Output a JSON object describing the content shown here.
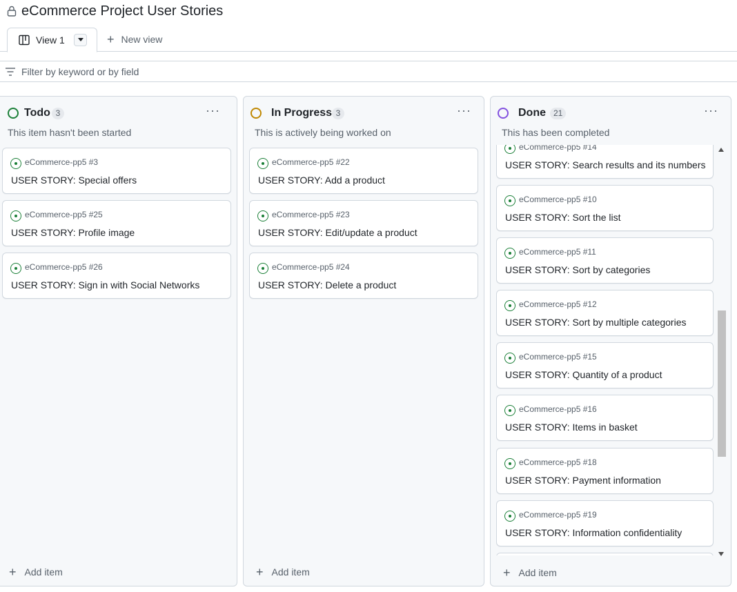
{
  "project": {
    "title": "eCommerce Project User Stories"
  },
  "tabs": {
    "active_label": "View 1",
    "new_view_label": "New view"
  },
  "filter": {
    "placeholder": "Filter by keyword or by field"
  },
  "columns": [
    {
      "name": "Todo",
      "count": "3",
      "description": "This item hasn't been started",
      "status_color": "#1a7f37",
      "add_label": "Add item",
      "cards": [
        {
          "ref": "eCommerce-pp5 #3",
          "title": "USER STORY: Special offers"
        },
        {
          "ref": "eCommerce-pp5 #25",
          "title": "USER STORY: Profile image"
        },
        {
          "ref": "eCommerce-pp5 #26",
          "title": "USER STORY: Sign in with Social Networks"
        }
      ]
    },
    {
      "name": "In Progress",
      "count": "3",
      "description": "This is actively being worked on",
      "status_color": "#bf8700",
      "add_label": "Add item",
      "cards": [
        {
          "ref": "eCommerce-pp5 #22",
          "title": "USER STORY: Add a product"
        },
        {
          "ref": "eCommerce-pp5 #23",
          "title": "USER STORY: Edit/update a product"
        },
        {
          "ref": "eCommerce-pp5 #24",
          "title": "USER STORY: Delete a product"
        }
      ]
    },
    {
      "name": "Done",
      "count": "21",
      "description": "This has been completed",
      "status_color": "#8250df",
      "add_label": "Add item",
      "cards": [
        {
          "ref": "eCommerce-pp5 #14",
          "title": "USER STORY: Search results and its numbers"
        },
        {
          "ref": "eCommerce-pp5 #10",
          "title": "USER STORY: Sort the list"
        },
        {
          "ref": "eCommerce-pp5 #11",
          "title": "USER STORY: Sort by categories"
        },
        {
          "ref": "eCommerce-pp5 #12",
          "title": "USER STORY: Sort by multiple categories"
        },
        {
          "ref": "eCommerce-pp5 #15",
          "title": "USER STORY: Quantity of a product"
        },
        {
          "ref": "eCommerce-pp5 #16",
          "title": "USER STORY: Items in basket"
        },
        {
          "ref": "eCommerce-pp5 #18",
          "title": "USER STORY: Payment information"
        },
        {
          "ref": "eCommerce-pp5 #19",
          "title": "USER STORY: Information confidentiality"
        }
      ]
    }
  ]
}
